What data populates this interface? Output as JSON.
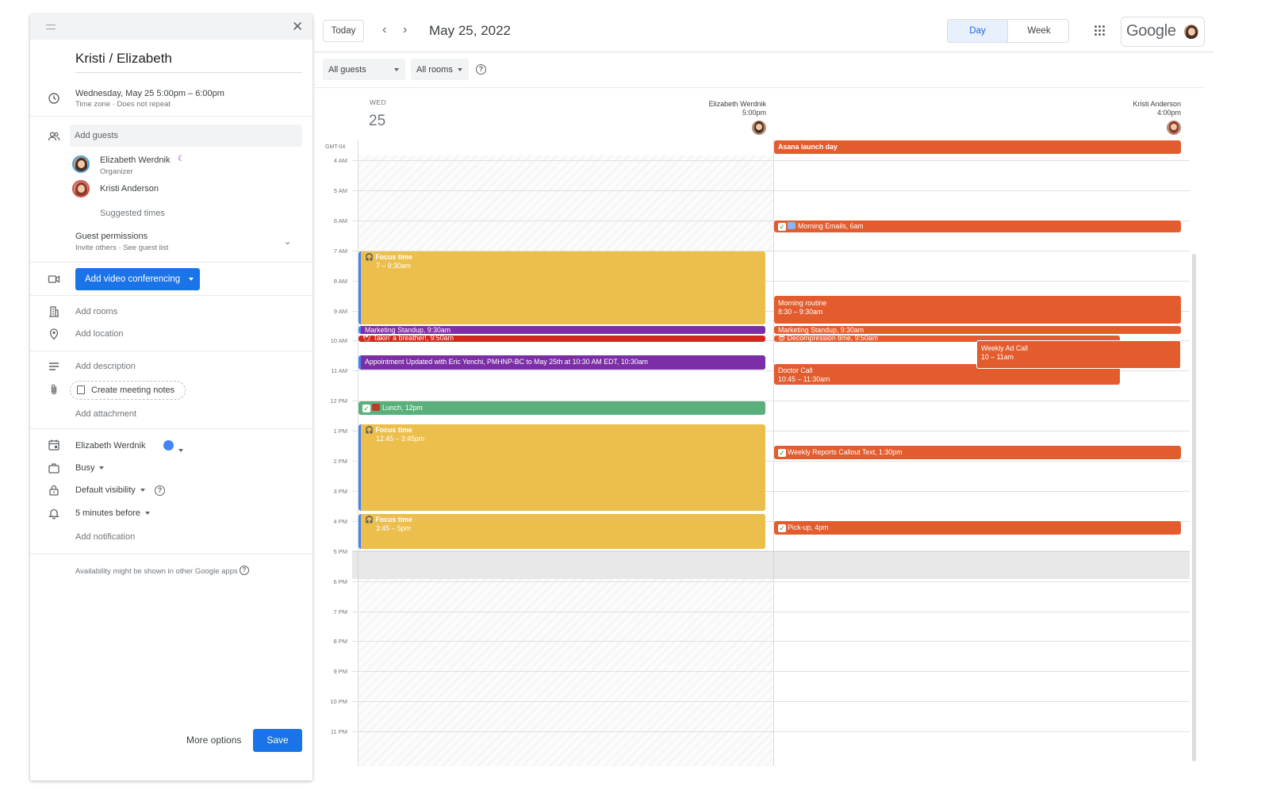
{
  "panel": {
    "title": "Kristi / Elizabeth",
    "date_line": "Wednesday, May 25    5:00pm  –  6:00pm",
    "date_sub": "Time zone · Does not repeat",
    "add_guests_placeholder": "Add guests",
    "guests": [
      {
        "name": "Elizabeth Werdnik",
        "role": "Organizer"
      },
      {
        "name": "Kristi Anderson",
        "role": ""
      }
    ],
    "suggested_times": "Suggested times",
    "guest_permissions": "Guest permissions",
    "guest_permissions_sub": "Invite others · See guest list",
    "video_button": "Add video conferencing",
    "add_rooms": "Add rooms",
    "add_location": "Add location",
    "add_description": "Add description",
    "create_notes": "Create meeting notes",
    "add_attachment": "Add attachment",
    "calendar_owner": "Elizabeth Werdnik",
    "calendar_color": "#4285f4",
    "busy": "Busy",
    "visibility": "Default visibility",
    "notification": "5 minutes before",
    "add_notification": "Add notification",
    "availability_note": "Availability might be shown in other Google apps",
    "more_options": "More options",
    "save": "Save"
  },
  "header": {
    "today": "Today",
    "date_title": "May 25, 2022",
    "view_day": "Day",
    "view_week": "Week",
    "brand": "Google",
    "filter_guests": "All guests",
    "filter_rooms": "All rooms"
  },
  "grid": {
    "day_abbr": "WED",
    "day_num": "25",
    "timezone": "GMT-04",
    "people": [
      {
        "name": "Elizabeth Werdnik",
        "time": "5:00pm"
      },
      {
        "name": "Kristi Anderson",
        "time": "4:00pm"
      }
    ],
    "hours": [
      "4 AM",
      "5 AM",
      "6 AM",
      "7 AM",
      "8 AM",
      "9 AM",
      "10 AM",
      "11 AM",
      "12 PM",
      "1 PM",
      "2 PM",
      "3 PM",
      "4 PM",
      "5 PM",
      "6 PM",
      "7 PM",
      "8 PM",
      "9 PM",
      "10 PM",
      "11 PM"
    ]
  },
  "events": {
    "asana": "Asana launch day",
    "morning_emails": "Morning Emails, 6am",
    "focus1_title": "Focus time",
    "focus1_time": "7 – 9:30am",
    "morning_routine_title": "Morning routine",
    "morning_routine_time": "8:30 – 9:30am",
    "marketing_left": "Marketing Standup, 9:30am",
    "marketing_right": "Marketing Standup, 9:30am",
    "breather": "Takin' a breather!, 9:50am",
    "decompression": "Decompression time, 9:50am",
    "weekly_ad_title": "Weekly Ad Call",
    "weekly_ad_time": "10 – 11am",
    "appointment": "Appointment Updated with Eric Yenchi, PMHNP-BC to May 25th at 10:30 AM EDT, 10:30am",
    "doctor_title": "Doctor Call",
    "doctor_time": "10:45 – 11:30am",
    "lunch": "Lunch, 12pm",
    "focus2_title": "Focus time",
    "focus2_time": "12:45 – 3:45pm",
    "weekly_reports": "Weekly Reports Callout Text, 1:30pm",
    "focus3_title": "Focus time",
    "focus3_time": "3:45 – 5pm",
    "pickup": "Pick-up, 4pm"
  }
}
